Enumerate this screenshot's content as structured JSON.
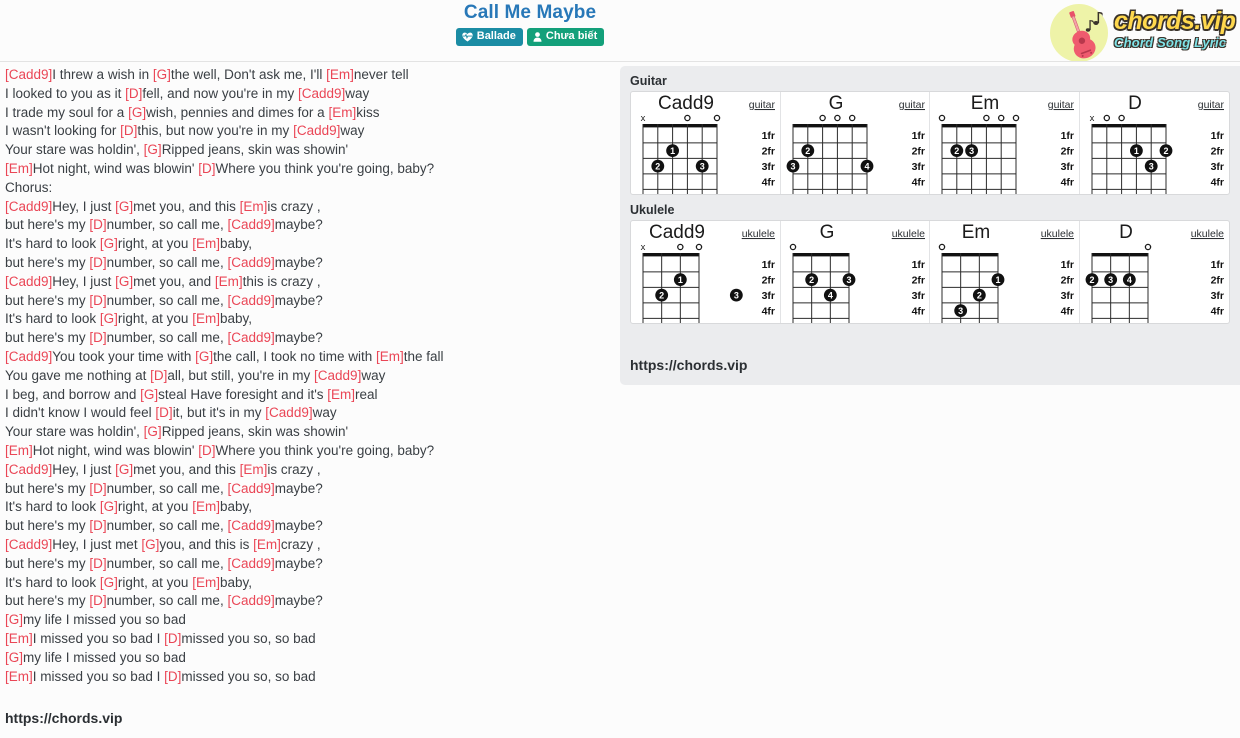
{
  "header": {
    "song_title": "Call Me Maybe",
    "badges": [
      {
        "label": "Ballade",
        "icon": "heartbeat-icon",
        "color": "#1b8ca4"
      },
      {
        "label": "Chưa biết",
        "icon": "user-icon",
        "color": "#13a07a"
      }
    ],
    "logo": {
      "main": "chords.vip",
      "sub": "Chord Song Lyric",
      "icon": "guitar-icon",
      "main_color": "#ffd84d",
      "sub_color": "#7fe3e8"
    }
  },
  "lyrics": {
    "lines": [
      [
        {
          "t": "chord",
          "v": "[Cadd9]"
        },
        {
          "t": "text",
          "v": "I threw a wish in "
        },
        {
          "t": "chord",
          "v": "[G]"
        },
        {
          "t": "text",
          "v": "the well, Don't ask me, I'll "
        },
        {
          "t": "chord",
          "v": "[Em]"
        },
        {
          "t": "text",
          "v": "never tell"
        }
      ],
      [
        {
          "t": "text",
          "v": "I looked to you as it "
        },
        {
          "t": "chord",
          "v": "[D]"
        },
        {
          "t": "text",
          "v": "fell, and now you're in my "
        },
        {
          "t": "chord",
          "v": "[Cadd9]"
        },
        {
          "t": "text",
          "v": "way"
        }
      ],
      [
        {
          "t": "text",
          "v": "I trade my soul for a "
        },
        {
          "t": "chord",
          "v": "[G]"
        },
        {
          "t": "text",
          "v": "wish, pennies and dimes for a "
        },
        {
          "t": "chord",
          "v": "[Em]"
        },
        {
          "t": "text",
          "v": "kiss"
        }
      ],
      [
        {
          "t": "text",
          "v": "I wasn't looking for "
        },
        {
          "t": "chord",
          "v": "[D]"
        },
        {
          "t": "text",
          "v": "this, but now you're in my "
        },
        {
          "t": "chord",
          "v": "[Cadd9]"
        },
        {
          "t": "text",
          "v": "way"
        }
      ],
      [
        {
          "t": "text",
          "v": "Your stare was holdin', "
        },
        {
          "t": "chord",
          "v": "[G]"
        },
        {
          "t": "text",
          "v": "Ripped jeans, skin was showin'"
        }
      ],
      [
        {
          "t": "chord",
          "v": "[Em]"
        },
        {
          "t": "text",
          "v": "Hot night, wind was blowin' "
        },
        {
          "t": "chord",
          "v": "[D]"
        },
        {
          "t": "text",
          "v": "Where you think you're going, baby?"
        }
      ],
      [
        {
          "t": "text",
          "v": "Chorus:"
        }
      ],
      [
        {
          "t": "chord",
          "v": "[Cadd9]"
        },
        {
          "t": "text",
          "v": "Hey, I just "
        },
        {
          "t": "chord",
          "v": "[G]"
        },
        {
          "t": "text",
          "v": "met you, and this "
        },
        {
          "t": "chord",
          "v": "[Em]"
        },
        {
          "t": "text",
          "v": "is crazy ,"
        }
      ],
      [
        {
          "t": "text",
          "v": "but here's my "
        },
        {
          "t": "chord",
          "v": "[D]"
        },
        {
          "t": "text",
          "v": "number, so call me, "
        },
        {
          "t": "chord",
          "v": "[Cadd9]"
        },
        {
          "t": "text",
          "v": "maybe?"
        }
      ],
      [
        {
          "t": "text",
          "v": "It's hard to look "
        },
        {
          "t": "chord",
          "v": "[G]"
        },
        {
          "t": "text",
          "v": "right, at you "
        },
        {
          "t": "chord",
          "v": "[Em]"
        },
        {
          "t": "text",
          "v": "baby,"
        }
      ],
      [
        {
          "t": "text",
          "v": "but here's my "
        },
        {
          "t": "chord",
          "v": "[D]"
        },
        {
          "t": "text",
          "v": "number, so call me, "
        },
        {
          "t": "chord",
          "v": "[Cadd9]"
        },
        {
          "t": "text",
          "v": "maybe?"
        }
      ],
      [
        {
          "t": "chord",
          "v": "[Cadd9]"
        },
        {
          "t": "text",
          "v": "Hey, I just "
        },
        {
          "t": "chord",
          "v": "[G]"
        },
        {
          "t": "text",
          "v": "met you, and "
        },
        {
          "t": "chord",
          "v": "[Em]"
        },
        {
          "t": "text",
          "v": "this is crazy ,"
        }
      ],
      [
        {
          "t": "text",
          "v": "but here's my "
        },
        {
          "t": "chord",
          "v": "[D]"
        },
        {
          "t": "text",
          "v": "number, so call me, "
        },
        {
          "t": "chord",
          "v": "[Cadd9]"
        },
        {
          "t": "text",
          "v": "maybe?"
        }
      ],
      [
        {
          "t": "text",
          "v": "It's hard to look "
        },
        {
          "t": "chord",
          "v": "[G]"
        },
        {
          "t": "text",
          "v": "right, at you "
        },
        {
          "t": "chord",
          "v": "[Em]"
        },
        {
          "t": "text",
          "v": "baby,"
        }
      ],
      [
        {
          "t": "text",
          "v": "but here's my "
        },
        {
          "t": "chord",
          "v": "[D]"
        },
        {
          "t": "text",
          "v": "number, so call me, "
        },
        {
          "t": "chord",
          "v": "[Cadd9]"
        },
        {
          "t": "text",
          "v": "maybe?"
        }
      ],
      [
        {
          "t": "chord",
          "v": "[Cadd9]"
        },
        {
          "t": "text",
          "v": "You took your time with "
        },
        {
          "t": "chord",
          "v": "[G]"
        },
        {
          "t": "text",
          "v": "the call, I took no time with "
        },
        {
          "t": "chord",
          "v": "[Em]"
        },
        {
          "t": "text",
          "v": "the fall"
        }
      ],
      [
        {
          "t": "text",
          "v": "You gave me nothing at "
        },
        {
          "t": "chord",
          "v": "[D]"
        },
        {
          "t": "text",
          "v": "all, but still, you're in my "
        },
        {
          "t": "chord",
          "v": "[Cadd9]"
        },
        {
          "t": "text",
          "v": "way"
        }
      ],
      [
        {
          "t": "text",
          "v": "I beg, and borrow and "
        },
        {
          "t": "chord",
          "v": "[G]"
        },
        {
          "t": "text",
          "v": "steal Have foresight and it's "
        },
        {
          "t": "chord",
          "v": "[Em]"
        },
        {
          "t": "text",
          "v": "real"
        }
      ],
      [
        {
          "t": "text",
          "v": "I didn't know I would feel "
        },
        {
          "t": "chord",
          "v": "[D]"
        },
        {
          "t": "text",
          "v": "it, but it's in my "
        },
        {
          "t": "chord",
          "v": "[Cadd9]"
        },
        {
          "t": "text",
          "v": "way"
        }
      ],
      [
        {
          "t": "text",
          "v": "Your stare was holdin', "
        },
        {
          "t": "chord",
          "v": "[G]"
        },
        {
          "t": "text",
          "v": "Ripped jeans, skin was showin'"
        }
      ],
      [
        {
          "t": "chord",
          "v": "[Em]"
        },
        {
          "t": "text",
          "v": "Hot night, wind was blowin' "
        },
        {
          "t": "chord",
          "v": "[D]"
        },
        {
          "t": "text",
          "v": "Where you think you're going, baby?"
        }
      ],
      [
        {
          "t": "chord",
          "v": "[Cadd9]"
        },
        {
          "t": "text",
          "v": "Hey, I just "
        },
        {
          "t": "chord",
          "v": "[G]"
        },
        {
          "t": "text",
          "v": "met you, and this "
        },
        {
          "t": "chord",
          "v": "[Em]"
        },
        {
          "t": "text",
          "v": "is crazy ,"
        }
      ],
      [
        {
          "t": "text",
          "v": "but here's my "
        },
        {
          "t": "chord",
          "v": "[D]"
        },
        {
          "t": "text",
          "v": "number, so call me, "
        },
        {
          "t": "chord",
          "v": "[Cadd9]"
        },
        {
          "t": "text",
          "v": "maybe?"
        }
      ],
      [
        {
          "t": "text",
          "v": "It's hard to look "
        },
        {
          "t": "chord",
          "v": "[G]"
        },
        {
          "t": "text",
          "v": "right, at you "
        },
        {
          "t": "chord",
          "v": "[Em]"
        },
        {
          "t": "text",
          "v": "baby,"
        }
      ],
      [
        {
          "t": "text",
          "v": "but here's my "
        },
        {
          "t": "chord",
          "v": "[D]"
        },
        {
          "t": "text",
          "v": "number, so call me, "
        },
        {
          "t": "chord",
          "v": "[Cadd9]"
        },
        {
          "t": "text",
          "v": "maybe?"
        }
      ],
      [
        {
          "t": "chord",
          "v": "[Cadd9]"
        },
        {
          "t": "text",
          "v": "Hey, I just met "
        },
        {
          "t": "chord",
          "v": "[G]"
        },
        {
          "t": "text",
          "v": "you, and this is "
        },
        {
          "t": "chord",
          "v": "[Em]"
        },
        {
          "t": "text",
          "v": "crazy ,"
        }
      ],
      [
        {
          "t": "text",
          "v": "but here's my "
        },
        {
          "t": "chord",
          "v": "[D]"
        },
        {
          "t": "text",
          "v": "number, so call me, "
        },
        {
          "t": "chord",
          "v": "[Cadd9]"
        },
        {
          "t": "text",
          "v": "maybe?"
        }
      ],
      [
        {
          "t": "text",
          "v": "It's hard to look "
        },
        {
          "t": "chord",
          "v": "[G]"
        },
        {
          "t": "text",
          "v": "right, at you "
        },
        {
          "t": "chord",
          "v": "[Em]"
        },
        {
          "t": "text",
          "v": "baby,"
        }
      ],
      [
        {
          "t": "text",
          "v": "but here's my "
        },
        {
          "t": "chord",
          "v": "[D]"
        },
        {
          "t": "text",
          "v": "number, so call me, "
        },
        {
          "t": "chord",
          "v": "[Cadd9]"
        },
        {
          "t": "text",
          "v": "maybe?"
        }
      ],
      [
        {
          "t": "chord",
          "v": "[G]"
        },
        {
          "t": "text",
          "v": "my life I missed you so bad"
        }
      ],
      [
        {
          "t": "chord",
          "v": "[Em]"
        },
        {
          "t": "text",
          "v": "I missed you so bad I "
        },
        {
          "t": "chord",
          "v": "[D]"
        },
        {
          "t": "text",
          "v": "missed you so, so bad"
        }
      ],
      [
        {
          "t": "chord",
          "v": "[G]"
        },
        {
          "t": "text",
          "v": "my life I missed you so bad"
        }
      ],
      [
        {
          "t": "chord",
          "v": "[Em]"
        },
        {
          "t": "text",
          "v": "I missed you so bad I "
        },
        {
          "t": "chord",
          "v": "[D]"
        },
        {
          "t": "text",
          "v": "missed you so, so bad"
        }
      ]
    ],
    "footer_url": "https://chords.vip"
  },
  "chord_panel": {
    "guitar_label": "Guitar",
    "ukulele_label": "Ukulele",
    "panel_url": "https://chords.vip",
    "guitar": [
      {
        "name": "Cadd9",
        "instrument": "guitar",
        "strings": 6,
        "fret_labels": [
          "1fr",
          "2fr",
          "3fr",
          "4fr"
        ],
        "open_marks": [
          "x",
          "",
          "",
          "o",
          "",
          "o"
        ],
        "dots": [
          {
            "string": 3,
            "fret": 2,
            "finger": "1"
          },
          {
            "string": 2,
            "fret": 3,
            "finger": "2"
          },
          {
            "string": 5,
            "fret": 3,
            "finger": "3"
          }
        ]
      },
      {
        "name": "G",
        "instrument": "guitar",
        "strings": 6,
        "fret_labels": [
          "1fr",
          "2fr",
          "3fr",
          "4fr"
        ],
        "open_marks": [
          "",
          "",
          "o",
          "o",
          "o",
          ""
        ],
        "dots": [
          {
            "string": 2,
            "fret": 2,
            "finger": "2"
          },
          {
            "string": 1,
            "fret": 3,
            "finger": "3"
          },
          {
            "string": 6,
            "fret": 3,
            "finger": "4"
          }
        ]
      },
      {
        "name": "Em",
        "instrument": "guitar",
        "strings": 6,
        "fret_labels": [
          "1fr",
          "2fr",
          "3fr",
          "4fr"
        ],
        "open_marks": [
          "o",
          "",
          "",
          "o",
          "o",
          "o"
        ],
        "dots": [
          {
            "string": 2,
            "fret": 2,
            "finger": "2"
          },
          {
            "string": 3,
            "fret": 2,
            "finger": "3"
          }
        ]
      },
      {
        "name": "D",
        "instrument": "guitar",
        "strings": 6,
        "fret_labels": [
          "1fr",
          "2fr",
          "3fr",
          "4fr"
        ],
        "open_marks": [
          "x",
          "o",
          "o",
          "",
          "",
          ""
        ],
        "dots": [
          {
            "string": 4,
            "fret": 2,
            "finger": "1"
          },
          {
            "string": 6,
            "fret": 2,
            "finger": "2"
          },
          {
            "string": 5,
            "fret": 3,
            "finger": "3"
          }
        ]
      }
    ],
    "ukulele": [
      {
        "name": "Cadd9",
        "instrument": "ukulele",
        "strings": 4,
        "fret_labels": [
          "1fr",
          "2fr",
          "3fr",
          "4fr"
        ],
        "open_marks": [
          "x",
          "",
          "o",
          "o"
        ],
        "dots": [
          {
            "string": 3,
            "fret": 2,
            "finger": "1"
          },
          {
            "string": 2,
            "fret": 3,
            "finger": "2"
          },
          {
            "string": 6,
            "fret": 3,
            "finger": "3"
          }
        ]
      },
      {
        "name": "G",
        "instrument": "ukulele",
        "strings": 4,
        "fret_labels": [
          "1fr",
          "2fr",
          "3fr",
          "4fr"
        ],
        "open_marks": [
          "o",
          "",
          "",
          ""
        ],
        "dots": [
          {
            "string": 2,
            "fret": 2,
            "finger": "2"
          },
          {
            "string": 4,
            "fret": 2,
            "finger": "3"
          },
          {
            "string": 3,
            "fret": 3,
            "finger": "4"
          }
        ]
      },
      {
        "name": "Em",
        "instrument": "ukulele",
        "strings": 4,
        "fret_labels": [
          "1fr",
          "2fr",
          "3fr",
          "4fr"
        ],
        "open_marks": [
          "o",
          "",
          "",
          ""
        ],
        "dots": [
          {
            "string": 4,
            "fret": 2,
            "finger": "1"
          },
          {
            "string": 3,
            "fret": 3,
            "finger": "2"
          },
          {
            "string": 2,
            "fret": 4,
            "finger": "3"
          }
        ]
      },
      {
        "name": "D",
        "instrument": "ukulele",
        "strings": 4,
        "fret_labels": [
          "1fr",
          "2fr",
          "3fr",
          "4fr"
        ],
        "open_marks": [
          "",
          "",
          "",
          "o"
        ],
        "dots": [
          {
            "string": 1,
            "fret": 2,
            "finger": "2"
          },
          {
            "string": 2,
            "fret": 2,
            "finger": "3"
          },
          {
            "string": 3,
            "fret": 2,
            "finger": "4"
          }
        ]
      }
    ]
  }
}
